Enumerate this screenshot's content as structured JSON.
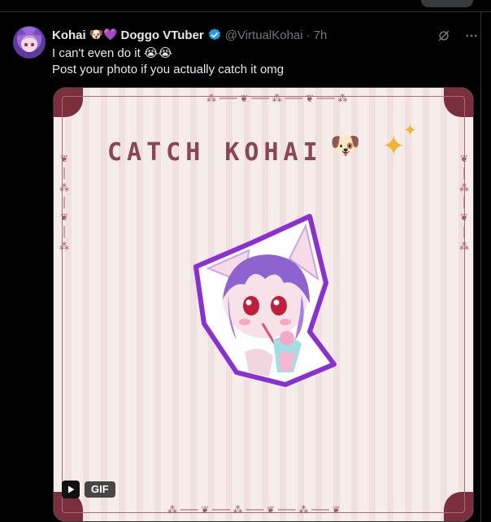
{
  "tweet": {
    "display_name": "Kohai",
    "name_emojis": "🐶💜",
    "name_suffix": "Doggo VTuber",
    "handle": "@VirtualKohai",
    "separator": "·",
    "time": "7h",
    "text_line1": "I can't even do it 😭😭",
    "text_line2": "Post your photo if you actually catch it omg"
  },
  "media": {
    "title": "CATCH KOHAI",
    "title_emoji": "🐶",
    "sparkle_icon": "sparkles-icon",
    "gif_label": "GIF"
  },
  "icons": {
    "grok": "grok-icon",
    "more": "more-icon",
    "verified": "verified-badge-icon"
  },
  "colors": {
    "verified": "#1d9bf0",
    "frame": "#7b2f3c",
    "title": "#8a4654",
    "character_outline": "#8a2fd0"
  }
}
